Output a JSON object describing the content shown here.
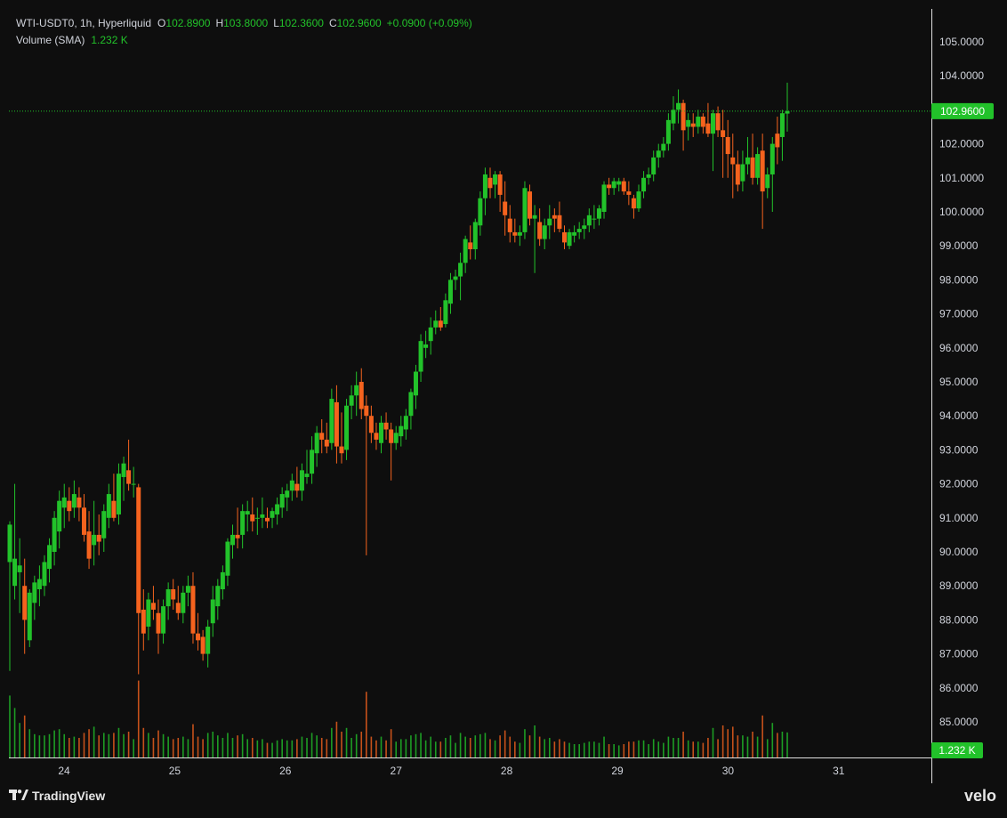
{
  "header": {
    "symbol": "WTI-USDT0, 1h, Hyperliquid",
    "open_label": "O",
    "open_value": "102.8900",
    "high_label": "H",
    "high_value": "103.8000",
    "low_label": "L",
    "low_value": "102.3600",
    "close_label": "C",
    "close_value": "102.9600",
    "change": "+0.0900 (+0.09%)",
    "volume_label": "Volume (SMA)",
    "volume_value": "1.232 K"
  },
  "axis": {
    "price_ticks": [
      "105.0000",
      "104.0000",
      "103.0000",
      "102.0000",
      "101.0000",
      "100.0000",
      "99.0000",
      "98.0000",
      "97.0000",
      "96.0000",
      "95.0000",
      "94.0000",
      "93.0000",
      "92.0000",
      "91.0000",
      "90.0000",
      "89.0000",
      "88.0000",
      "87.0000",
      "86.0000",
      "85.0000"
    ],
    "date_ticks": [
      "24",
      "25",
      "26",
      "27",
      "28",
      "29",
      "30",
      "31"
    ],
    "last_price_label": "102.9600",
    "volume_label": "1.232 K"
  },
  "brand": {
    "tradingview": "TradingView",
    "velo": "velo"
  },
  "colors": {
    "up": "#22c22a",
    "down": "#f5631e",
    "background": "#0e0e0e",
    "grid_line": "#2a2a2a",
    "axis_text": "#d1d4dc"
  },
  "chart_data": {
    "type": "candlestick",
    "interval": "1h",
    "x_axis": "date (day of month)",
    "y_range": [
      84.5,
      105.5
    ],
    "last_price": 102.96,
    "candles": [
      {
        "o": 89.7,
        "h": 90.9,
        "l": 86.5,
        "c": 90.8
      },
      {
        "o": 89.0,
        "h": 92.0,
        "l": 88.6,
        "c": 89.8
      },
      {
        "o": 89.4,
        "h": 90.4,
        "l": 88.2,
        "c": 89.6
      },
      {
        "o": 89.0,
        "h": 89.8,
        "l": 87.0,
        "c": 88.0
      },
      {
        "o": 87.4,
        "h": 88.9,
        "l": 87.2,
        "c": 88.8
      },
      {
        "o": 88.5,
        "h": 89.3,
        "l": 88.0,
        "c": 89.1
      },
      {
        "o": 88.9,
        "h": 89.6,
        "l": 88.4,
        "c": 89.2
      },
      {
        "o": 89.0,
        "h": 89.9,
        "l": 88.7,
        "c": 89.7
      },
      {
        "o": 89.5,
        "h": 90.4,
        "l": 89.1,
        "c": 90.2
      },
      {
        "o": 90.0,
        "h": 91.2,
        "l": 89.6,
        "c": 91.0
      },
      {
        "o": 90.6,
        "h": 91.8,
        "l": 90.1,
        "c": 91.5
      },
      {
        "o": 91.3,
        "h": 92.0,
        "l": 90.7,
        "c": 91.6
      },
      {
        "o": 91.5,
        "h": 91.9,
        "l": 90.9,
        "c": 91.2
      },
      {
        "o": 91.3,
        "h": 92.1,
        "l": 91.0,
        "c": 91.7
      },
      {
        "o": 91.6,
        "h": 91.9,
        "l": 90.9,
        "c": 91.3
      },
      {
        "o": 91.3,
        "h": 91.7,
        "l": 90.3,
        "c": 90.5
      },
      {
        "o": 90.6,
        "h": 91.2,
        "l": 89.5,
        "c": 89.8
      },
      {
        "o": 90.2,
        "h": 91.5,
        "l": 89.6,
        "c": 90.5
      },
      {
        "o": 90.5,
        "h": 91.1,
        "l": 89.9,
        "c": 90.3
      },
      {
        "o": 90.4,
        "h": 91.4,
        "l": 90.0,
        "c": 91.2
      },
      {
        "o": 91.0,
        "h": 92.0,
        "l": 90.7,
        "c": 91.7
      },
      {
        "o": 91.5,
        "h": 92.3,
        "l": 90.9,
        "c": 91.0
      },
      {
        "o": 91.1,
        "h": 92.6,
        "l": 90.8,
        "c": 92.3
      },
      {
        "o": 92.2,
        "h": 92.8,
        "l": 91.5,
        "c": 92.6
      },
      {
        "o": 92.4,
        "h": 93.3,
        "l": 91.8,
        "c": 92.0
      },
      {
        "o": 92.0,
        "h": 92.5,
        "l": 91.6,
        "c": 92.0
      },
      {
        "o": 91.9,
        "h": 92.0,
        "l": 86.4,
        "c": 88.2
      },
      {
        "o": 88.3,
        "h": 88.9,
        "l": 87.1,
        "c": 87.6
      },
      {
        "o": 87.8,
        "h": 88.8,
        "l": 87.4,
        "c": 88.6
      },
      {
        "o": 88.5,
        "h": 89.0,
        "l": 88.0,
        "c": 88.3
      },
      {
        "o": 88.2,
        "h": 88.6,
        "l": 87.0,
        "c": 87.6
      },
      {
        "o": 87.6,
        "h": 88.6,
        "l": 87.3,
        "c": 88.4
      },
      {
        "o": 88.4,
        "h": 89.1,
        "l": 88.0,
        "c": 88.9
      },
      {
        "o": 88.9,
        "h": 89.2,
        "l": 88.3,
        "c": 88.6
      },
      {
        "o": 88.5,
        "h": 89.0,
        "l": 88.0,
        "c": 88.2
      },
      {
        "o": 88.2,
        "h": 89.0,
        "l": 87.9,
        "c": 88.8
      },
      {
        "o": 88.8,
        "h": 89.3,
        "l": 88.4,
        "c": 89.0
      },
      {
        "o": 89.0,
        "h": 89.4,
        "l": 87.3,
        "c": 87.6
      },
      {
        "o": 87.6,
        "h": 88.2,
        "l": 87.1,
        "c": 87.4
      },
      {
        "o": 87.5,
        "h": 87.7,
        "l": 86.8,
        "c": 87.0
      },
      {
        "o": 87.0,
        "h": 88.0,
        "l": 86.6,
        "c": 87.8
      },
      {
        "o": 87.9,
        "h": 89.0,
        "l": 87.5,
        "c": 88.6
      },
      {
        "o": 88.4,
        "h": 89.2,
        "l": 88.0,
        "c": 89.0
      },
      {
        "o": 88.9,
        "h": 89.6,
        "l": 88.6,
        "c": 89.4
      },
      {
        "o": 89.3,
        "h": 90.4,
        "l": 89.0,
        "c": 90.3
      },
      {
        "o": 90.2,
        "h": 90.8,
        "l": 89.8,
        "c": 90.5
      },
      {
        "o": 90.5,
        "h": 91.3,
        "l": 90.1,
        "c": 90.4
      },
      {
        "o": 90.5,
        "h": 91.4,
        "l": 90.1,
        "c": 91.2
      },
      {
        "o": 91.1,
        "h": 91.5,
        "l": 90.6,
        "c": 91.2
      },
      {
        "o": 91.1,
        "h": 91.6,
        "l": 90.6,
        "c": 90.9
      },
      {
        "o": 91.0,
        "h": 91.3,
        "l": 90.5,
        "c": 91.0
      },
      {
        "o": 91.0,
        "h": 91.6,
        "l": 90.7,
        "c": 91.1
      },
      {
        "o": 91.0,
        "h": 91.3,
        "l": 90.7,
        "c": 90.9
      },
      {
        "o": 91.0,
        "h": 91.3,
        "l": 90.7,
        "c": 91.2
      },
      {
        "o": 91.1,
        "h": 91.6,
        "l": 90.8,
        "c": 91.4
      },
      {
        "o": 91.3,
        "h": 91.9,
        "l": 91.0,
        "c": 91.7
      },
      {
        "o": 91.6,
        "h": 92.0,
        "l": 91.2,
        "c": 91.8
      },
      {
        "o": 91.8,
        "h": 92.3,
        "l": 91.5,
        "c": 92.1
      },
      {
        "o": 92.0,
        "h": 92.5,
        "l": 91.6,
        "c": 91.8
      },
      {
        "o": 91.8,
        "h": 92.6,
        "l": 91.5,
        "c": 92.4
      },
      {
        "o": 92.2,
        "h": 93.0,
        "l": 92.0,
        "c": 92.3
      },
      {
        "o": 92.3,
        "h": 93.4,
        "l": 92.0,
        "c": 93.0
      },
      {
        "o": 92.9,
        "h": 93.7,
        "l": 92.5,
        "c": 93.5
      },
      {
        "o": 93.5,
        "h": 93.9,
        "l": 92.9,
        "c": 93.3
      },
      {
        "o": 93.3,
        "h": 93.8,
        "l": 92.9,
        "c": 93.1
      },
      {
        "o": 93.2,
        "h": 94.8,
        "l": 93.0,
        "c": 94.5
      },
      {
        "o": 94.4,
        "h": 94.9,
        "l": 92.6,
        "c": 93.1
      },
      {
        "o": 93.1,
        "h": 94.1,
        "l": 92.6,
        "c": 92.9
      },
      {
        "o": 93.0,
        "h": 94.5,
        "l": 92.7,
        "c": 94.3
      },
      {
        "o": 94.3,
        "h": 94.9,
        "l": 93.9,
        "c": 94.6
      },
      {
        "o": 94.6,
        "h": 95.3,
        "l": 94.0,
        "c": 94.9
      },
      {
        "o": 95.0,
        "h": 95.4,
        "l": 93.9,
        "c": 94.2
      },
      {
        "o": 94.3,
        "h": 94.6,
        "l": 89.9,
        "c": 94.0
      },
      {
        "o": 94.0,
        "h": 94.3,
        "l": 93.2,
        "c": 93.5
      },
      {
        "o": 93.5,
        "h": 93.8,
        "l": 93.0,
        "c": 93.3
      },
      {
        "o": 93.2,
        "h": 94.0,
        "l": 92.9,
        "c": 93.8
      },
      {
        "o": 93.8,
        "h": 94.1,
        "l": 93.3,
        "c": 93.6
      },
      {
        "o": 93.6,
        "h": 93.8,
        "l": 92.1,
        "c": 93.2
      },
      {
        "o": 93.2,
        "h": 93.7,
        "l": 93.0,
        "c": 93.5
      },
      {
        "o": 93.4,
        "h": 94.0,
        "l": 93.1,
        "c": 93.7
      },
      {
        "o": 93.6,
        "h": 94.2,
        "l": 93.3,
        "c": 94.0
      },
      {
        "o": 94.0,
        "h": 94.8,
        "l": 93.6,
        "c": 94.7
      },
      {
        "o": 94.6,
        "h": 95.5,
        "l": 94.2,
        "c": 95.3
      },
      {
        "o": 95.3,
        "h": 96.4,
        "l": 95.0,
        "c": 96.2
      },
      {
        "o": 96.0,
        "h": 96.5,
        "l": 95.7,
        "c": 96.1
      },
      {
        "o": 96.2,
        "h": 96.9,
        "l": 95.8,
        "c": 96.6
      },
      {
        "o": 96.6,
        "h": 97.1,
        "l": 96.4,
        "c": 96.8
      },
      {
        "o": 96.8,
        "h": 97.2,
        "l": 96.5,
        "c": 96.6
      },
      {
        "o": 96.7,
        "h": 97.6,
        "l": 96.6,
        "c": 97.4
      },
      {
        "o": 97.3,
        "h": 98.2,
        "l": 97.0,
        "c": 98.0
      },
      {
        "o": 98.0,
        "h": 98.3,
        "l": 97.7,
        "c": 98.1
      },
      {
        "o": 98.1,
        "h": 98.8,
        "l": 97.4,
        "c": 98.5
      },
      {
        "o": 98.5,
        "h": 99.3,
        "l": 98.2,
        "c": 99.2
      },
      {
        "o": 99.1,
        "h": 99.6,
        "l": 98.6,
        "c": 98.9
      },
      {
        "o": 98.9,
        "h": 99.8,
        "l": 98.6,
        "c": 99.7
      },
      {
        "o": 99.6,
        "h": 100.6,
        "l": 99.3,
        "c": 100.4
      },
      {
        "o": 100.4,
        "h": 101.3,
        "l": 99.9,
        "c": 101.1
      },
      {
        "o": 101.0,
        "h": 101.3,
        "l": 100.4,
        "c": 100.7
      },
      {
        "o": 100.8,
        "h": 101.2,
        "l": 100.4,
        "c": 101.1
      },
      {
        "o": 101.1,
        "h": 101.2,
        "l": 100.0,
        "c": 100.5
      },
      {
        "o": 100.3,
        "h": 100.9,
        "l": 99.3,
        "c": 99.9
      },
      {
        "o": 99.8,
        "h": 100.2,
        "l": 99.1,
        "c": 99.4
      },
      {
        "o": 99.4,
        "h": 99.8,
        "l": 99.1,
        "c": 99.3
      },
      {
        "o": 99.3,
        "h": 99.6,
        "l": 99.0,
        "c": 99.4
      },
      {
        "o": 99.4,
        "h": 100.9,
        "l": 99.2,
        "c": 100.7
      },
      {
        "o": 100.6,
        "h": 100.8,
        "l": 99.6,
        "c": 99.8
      },
      {
        "o": 99.8,
        "h": 100.2,
        "l": 98.2,
        "c": 99.9
      },
      {
        "o": 99.7,
        "h": 100.1,
        "l": 99.0,
        "c": 99.2
      },
      {
        "o": 99.2,
        "h": 99.8,
        "l": 98.9,
        "c": 99.6
      },
      {
        "o": 99.6,
        "h": 100.2,
        "l": 99.2,
        "c": 99.8
      },
      {
        "o": 99.9,
        "h": 100.1,
        "l": 99.4,
        "c": 99.8
      },
      {
        "o": 99.9,
        "h": 100.3,
        "l": 99.4,
        "c": 99.5
      },
      {
        "o": 99.4,
        "h": 99.6,
        "l": 98.9,
        "c": 99.1
      },
      {
        "o": 99.0,
        "h": 99.5,
        "l": 98.9,
        "c": 99.4
      },
      {
        "o": 99.3,
        "h": 99.6,
        "l": 99.1,
        "c": 99.4
      },
      {
        "o": 99.4,
        "h": 99.7,
        "l": 99.2,
        "c": 99.5
      },
      {
        "o": 99.5,
        "h": 99.8,
        "l": 99.2,
        "c": 99.6
      },
      {
        "o": 99.6,
        "h": 100.1,
        "l": 99.4,
        "c": 99.9
      },
      {
        "o": 99.8,
        "h": 100.2,
        "l": 99.5,
        "c": 99.8
      },
      {
        "o": 99.8,
        "h": 100.2,
        "l": 99.6,
        "c": 100.1
      },
      {
        "o": 100.0,
        "h": 100.9,
        "l": 99.8,
        "c": 100.8
      },
      {
        "o": 100.8,
        "h": 101.0,
        "l": 100.5,
        "c": 100.7
      },
      {
        "o": 100.7,
        "h": 101.0,
        "l": 100.5,
        "c": 100.9
      },
      {
        "o": 100.8,
        "h": 101.0,
        "l": 100.6,
        "c": 100.9
      },
      {
        "o": 100.9,
        "h": 101.0,
        "l": 100.5,
        "c": 100.6
      },
      {
        "o": 100.6,
        "h": 100.9,
        "l": 100.2,
        "c": 100.5
      },
      {
        "o": 100.4,
        "h": 100.5,
        "l": 99.8,
        "c": 100.1
      },
      {
        "o": 100.1,
        "h": 100.8,
        "l": 100.0,
        "c": 100.6
      },
      {
        "o": 100.6,
        "h": 101.2,
        "l": 100.4,
        "c": 101.0
      },
      {
        "o": 101.0,
        "h": 101.3,
        "l": 100.8,
        "c": 101.1
      },
      {
        "o": 101.1,
        "h": 101.8,
        "l": 100.9,
        "c": 101.6
      },
      {
        "o": 101.6,
        "h": 102.0,
        "l": 101.3,
        "c": 101.8
      },
      {
        "o": 101.8,
        "h": 102.2,
        "l": 101.6,
        "c": 102.0
      },
      {
        "o": 102.0,
        "h": 102.9,
        "l": 101.8,
        "c": 102.7
      },
      {
        "o": 102.6,
        "h": 103.4,
        "l": 102.4,
        "c": 103.0
      },
      {
        "o": 103.0,
        "h": 103.6,
        "l": 102.6,
        "c": 103.2
      },
      {
        "o": 103.2,
        "h": 103.3,
        "l": 101.8,
        "c": 102.4
      },
      {
        "o": 102.5,
        "h": 102.9,
        "l": 102.1,
        "c": 102.7
      },
      {
        "o": 102.6,
        "h": 102.9,
        "l": 102.2,
        "c": 102.5
      },
      {
        "o": 102.5,
        "h": 103.0,
        "l": 102.3,
        "c": 102.8
      },
      {
        "o": 102.8,
        "h": 102.9,
        "l": 102.3,
        "c": 102.5
      },
      {
        "o": 102.6,
        "h": 103.2,
        "l": 102.2,
        "c": 102.3
      },
      {
        "o": 102.3,
        "h": 103.0,
        "l": 101.2,
        "c": 102.9
      },
      {
        "o": 102.9,
        "h": 103.1,
        "l": 102.2,
        "c": 102.4
      },
      {
        "o": 102.4,
        "h": 103.0,
        "l": 101.0,
        "c": 102.2
      },
      {
        "o": 102.2,
        "h": 102.7,
        "l": 101.0,
        "c": 101.7
      },
      {
        "o": 101.6,
        "h": 102.3,
        "l": 100.4,
        "c": 101.4
      },
      {
        "o": 101.4,
        "h": 101.8,
        "l": 100.6,
        "c": 100.8
      },
      {
        "o": 100.9,
        "h": 101.8,
        "l": 100.6,
        "c": 101.4
      },
      {
        "o": 101.4,
        "h": 102.2,
        "l": 101.1,
        "c": 101.6
      },
      {
        "o": 101.6,
        "h": 102.3,
        "l": 100.8,
        "c": 101.0
      },
      {
        "o": 101.0,
        "h": 101.9,
        "l": 100.8,
        "c": 101.7
      },
      {
        "o": 101.8,
        "h": 102.3,
        "l": 99.5,
        "c": 100.6
      },
      {
        "o": 100.7,
        "h": 101.3,
        "l": 100.4,
        "c": 101.1
      },
      {
        "o": 101.1,
        "h": 102.2,
        "l": 100.0,
        "c": 102.0
      },
      {
        "o": 102.3,
        "h": 102.8,
        "l": 101.4,
        "c": 101.9
      },
      {
        "o": 102.2,
        "h": 103.0,
        "l": 101.5,
        "c": 102.9
      },
      {
        "o": 102.89,
        "h": 103.8,
        "l": 102.36,
        "c": 102.96
      }
    ],
    "volume_sma": 1.232,
    "volume_unit": "K"
  }
}
